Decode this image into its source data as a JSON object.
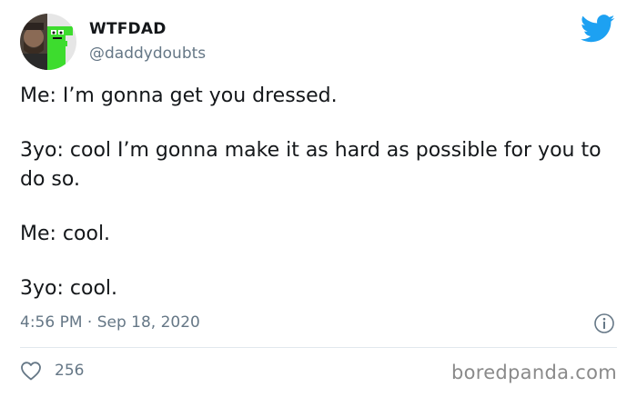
{
  "tweet": {
    "author": {
      "display_name": "WTFDAD",
      "handle": "@daddydoubts"
    },
    "body": [
      "Me: I’m gonna get you dressed.",
      "3yo: cool I’m gonna make it as hard as possible for you to do so.",
      "Me: cool.",
      "3yo: cool."
    ],
    "timestamp": "4:56 PM · Sep 18, 2020",
    "like_count": "256",
    "icons": {
      "brand": "twitter-bird-icon",
      "info": "info-icon",
      "like": "heart-icon"
    },
    "colors": {
      "brand_blue": "#1da1f2",
      "muted_text": "#657786",
      "body_text": "#14171a",
      "avatar_green": "#3ddc2e"
    }
  },
  "watermark": {
    "text": "boredpanda.com"
  }
}
